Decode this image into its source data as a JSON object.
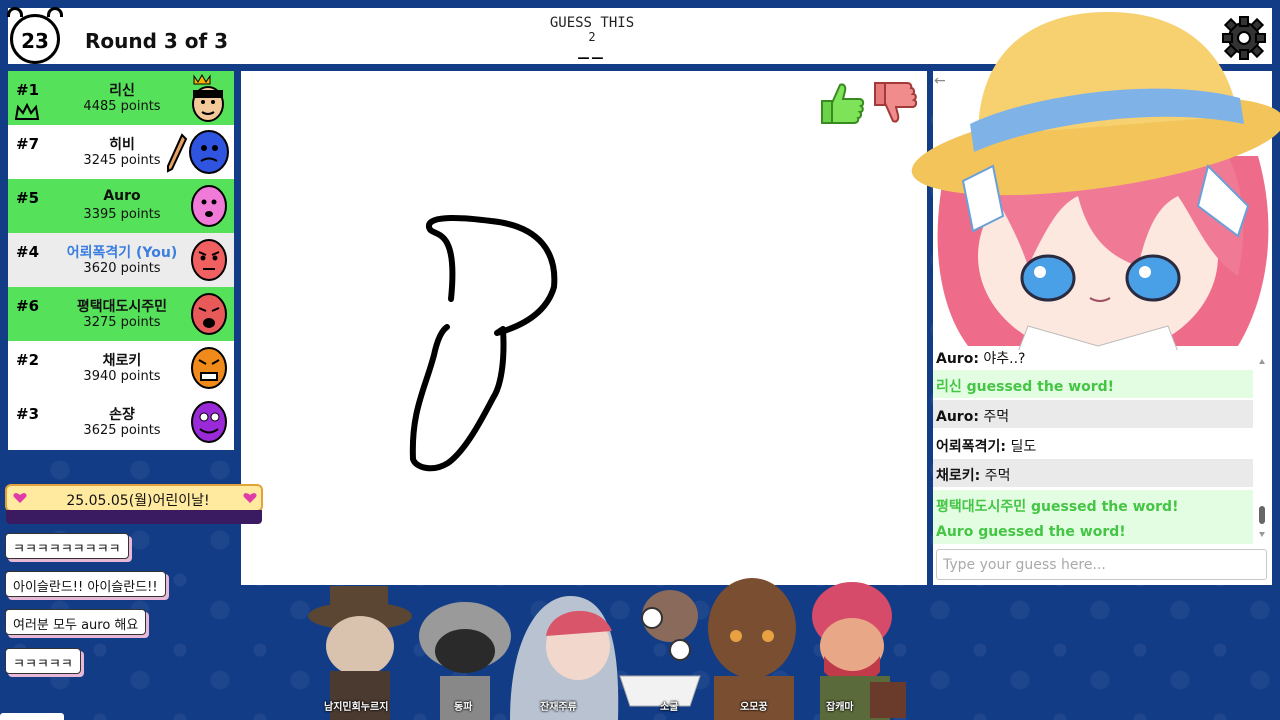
{
  "topbar": {
    "timer": "23",
    "round": "Round 3 of 3",
    "guess_label": "GUESS THIS",
    "guess_count": "2",
    "guess_blanks": "__"
  },
  "players": [
    {
      "rank": "#1",
      "name": "리신",
      "points": "4485 points",
      "highlight": true,
      "you": false
    },
    {
      "rank": "#7",
      "name": "히비",
      "points": "3245 points",
      "highlight": false,
      "you": false
    },
    {
      "rank": "#5",
      "name": "Auro",
      "points": "3395 points",
      "highlight": true,
      "you": false
    },
    {
      "rank": "#4",
      "name": "어뢰폭격기 (You)",
      "points": "3620 points",
      "highlight": false,
      "you": true
    },
    {
      "rank": "#6",
      "name": "평택대도시주민",
      "points": "3275 points",
      "highlight": true,
      "you": false
    },
    {
      "rank": "#2",
      "name": "채로키",
      "points": "3940 points",
      "highlight": false,
      "you": false
    },
    {
      "rank": "#3",
      "name": "손쟝",
      "points": "3625 points",
      "highlight": false,
      "you": false
    }
  ],
  "chat": {
    "messages": [
      {
        "user": "Auro:",
        "text": "야추..?",
        "type": "normal"
      },
      {
        "user": "",
        "text": "리신 guessed the word!",
        "type": "guessed"
      },
      {
        "user": "Auro:",
        "text": "주먹",
        "type": "normal"
      },
      {
        "user": "어뢰폭격기:",
        "text": "딜도",
        "type": "normal"
      },
      {
        "user": "채로키:",
        "text": "주먹",
        "type": "normal"
      },
      {
        "user": "",
        "text": "평택대도시주민 guessed the word!",
        "type": "guessed"
      },
      {
        "user": "",
        "text": "Auro guessed the word!",
        "type": "guessed"
      }
    ],
    "input_placeholder": "Type your guess here..."
  },
  "overlay": {
    "announcement": "25.05.05(월)어린이날!",
    "bubbles": [
      "ㅋㅋㅋㅋㅋㅋㅋㅋㅋ",
      "아이슬란드!! 아이슬란드!!",
      "여러분 모두 auro 해요",
      "ㅋㅋㅋㅋㅋ"
    ],
    "character_labels": [
      "남지민회누르지",
      "동파",
      "잔재주류",
      "소굴",
      "오모꿍",
      "잡캐마"
    ]
  },
  "colors": {
    "background": "#123c86",
    "green_row": "#56e15a",
    "you_name": "#3b7de0",
    "guessed_text": "#44c544"
  }
}
